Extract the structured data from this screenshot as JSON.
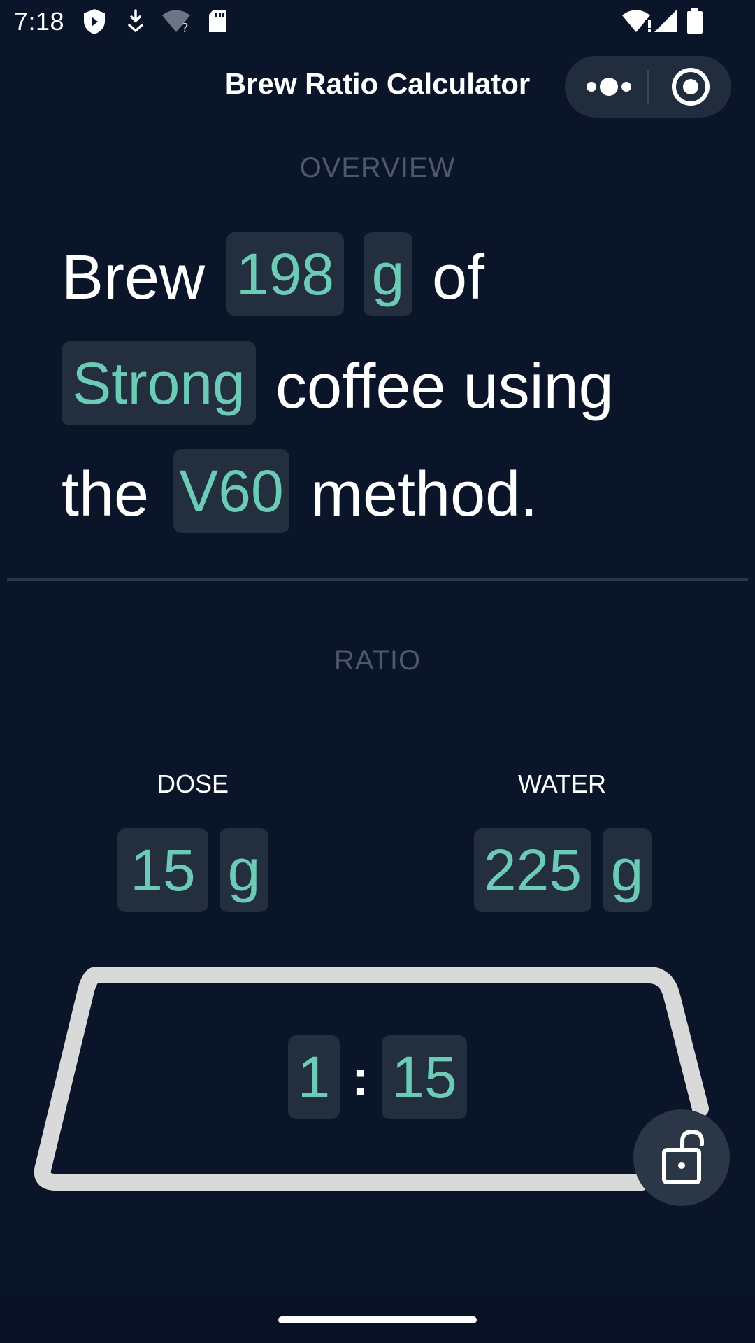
{
  "status_bar": {
    "time": "7:18",
    "left_icons": [
      "shield-icon",
      "download-icon",
      "wifi-question-icon",
      "sd-card-icon"
    ],
    "right_icons": [
      "wifi-alert-icon",
      "cell-signal-icon",
      "battery-icon"
    ]
  },
  "header": {
    "title": "Brew Ratio Calculator",
    "capsule_icons": [
      "more-dots-icon",
      "close-target-icon"
    ]
  },
  "overview": {
    "section_label": "OVERVIEW",
    "word_brew": "Brew",
    "amount": "198",
    "amount_unit": "g",
    "word_of": "of",
    "strength": "Strong",
    "word_coffee_using": "coffee using",
    "word_the": "the",
    "method": "V60",
    "word_method": "method."
  },
  "ratio": {
    "section_label": "RATIO",
    "dose_label": "DOSE",
    "dose_value": "15",
    "dose_unit": "g",
    "water_label": "WATER",
    "water_value": "225",
    "water_unit": "g",
    "ratio_left": "1",
    "ratio_separator": ":",
    "ratio_right": "15"
  },
  "colors": {
    "background": "#0b152a",
    "chip": "#232e3f",
    "accent": "#6ccbb7",
    "frame": "#d9d9d9"
  },
  "lock_icon": "unlocked-padlock-icon"
}
